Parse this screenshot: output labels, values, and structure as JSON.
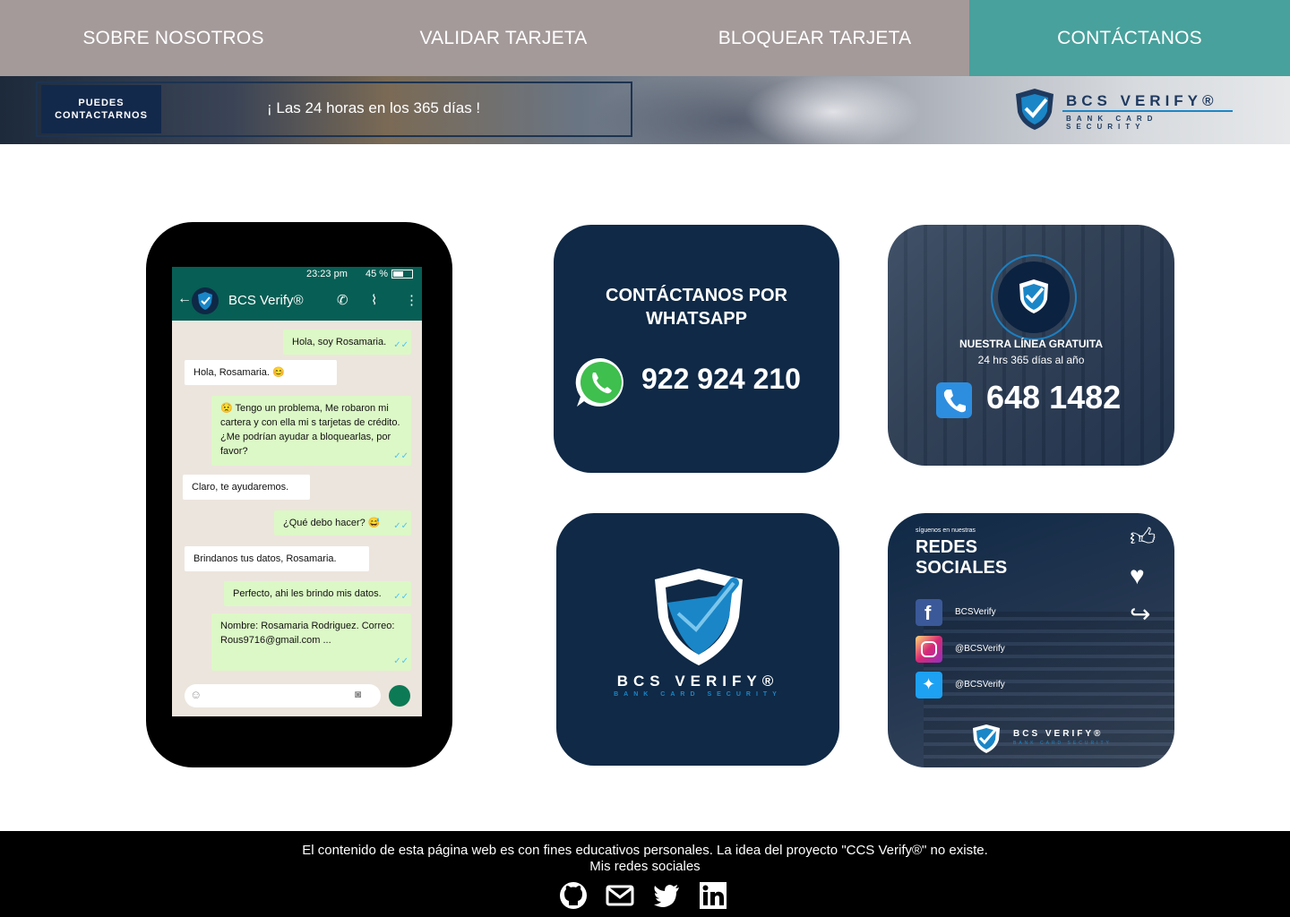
{
  "nav": {
    "items": [
      {
        "label": "SOBRE NOSOTROS"
      },
      {
        "label": "VALIDAR TARJETA"
      },
      {
        "label": "BLOQUEAR TARJETA"
      },
      {
        "label": "CONTÁCTANOS"
      }
    ],
    "active_color": "#48a19c",
    "bg_color": "#a49a9a"
  },
  "banner": {
    "badge_line1": "PUEDES",
    "badge_line2": "CONTACTARNOS",
    "tagline": "¡ Las 24 horas en los 365 días !",
    "logo_name": "BCS VERIFY®",
    "logo_sub": "BANK CARD SECURITY"
  },
  "phone": {
    "status_time": "23:23 pm",
    "status_battery": "45 %",
    "contact_name": "BCS Verify®",
    "messages": [
      {
        "text": "Hola, soy Rosamaria.",
        "side": "out"
      },
      {
        "text": "Hola, Rosamaria. 😊",
        "side": "in"
      },
      {
        "text": "😟 Tengo un problema, Me robaron mi cartera y con ella mi  s tarjetas de crédito. ¿Me podrían ayudar a bloquearlas, por favor?",
        "side": "out"
      },
      {
        "text": "Claro, te ayudaremos.",
        "side": "in"
      },
      {
        "text": "¿Qué debo hacer? 😅",
        "side": "out"
      },
      {
        "text": "Brindanos tus datos, Rosamaria.",
        "side": "in"
      },
      {
        "text": "Perfecto, ahi les brindo mis datos.",
        "side": "out"
      },
      {
        "text": "Nombre: Rosamaria Rodriguez. Correo: Rous9716@gmail.com ...",
        "side": "out"
      }
    ]
  },
  "whatsapp_card": {
    "title_line1": "CONTÁCTANOS POR",
    "title_line2": "WHATSAPP",
    "number": "922 924 210"
  },
  "hotline_card": {
    "title": "NUESTRA LÍNEA GRATUITA",
    "subtitle": "24 hrs 365 días al año",
    "number": "648 1482"
  },
  "logo_card": {
    "name": "BCS VERIFY®",
    "sub": "BANK CARD SECURITY"
  },
  "social_card": {
    "small": "síguenos en nuestras",
    "title_line1": "REDES",
    "title_line2": "SOCIALES",
    "accounts": [
      {
        "icon": "facebook-icon",
        "handle": "BCSVerify"
      },
      {
        "icon": "instagram-icon",
        "handle": "@BCSVerify"
      },
      {
        "icon": "twitter-icon",
        "handle": "@BCSVerify"
      }
    ],
    "logo_name": "BCS VERIFY®",
    "logo_sub": "BANK CARD SECURITY"
  },
  "footer": {
    "disclaimer": "El contenido de esta página web es con fines educativos personales. La idea del proyecto \"CCS Verify®\" no existe.",
    "social_label": "Mis redes sociales",
    "icons": [
      "github-icon",
      "mail-icon",
      "twitter-icon",
      "linkedin-icon"
    ]
  }
}
